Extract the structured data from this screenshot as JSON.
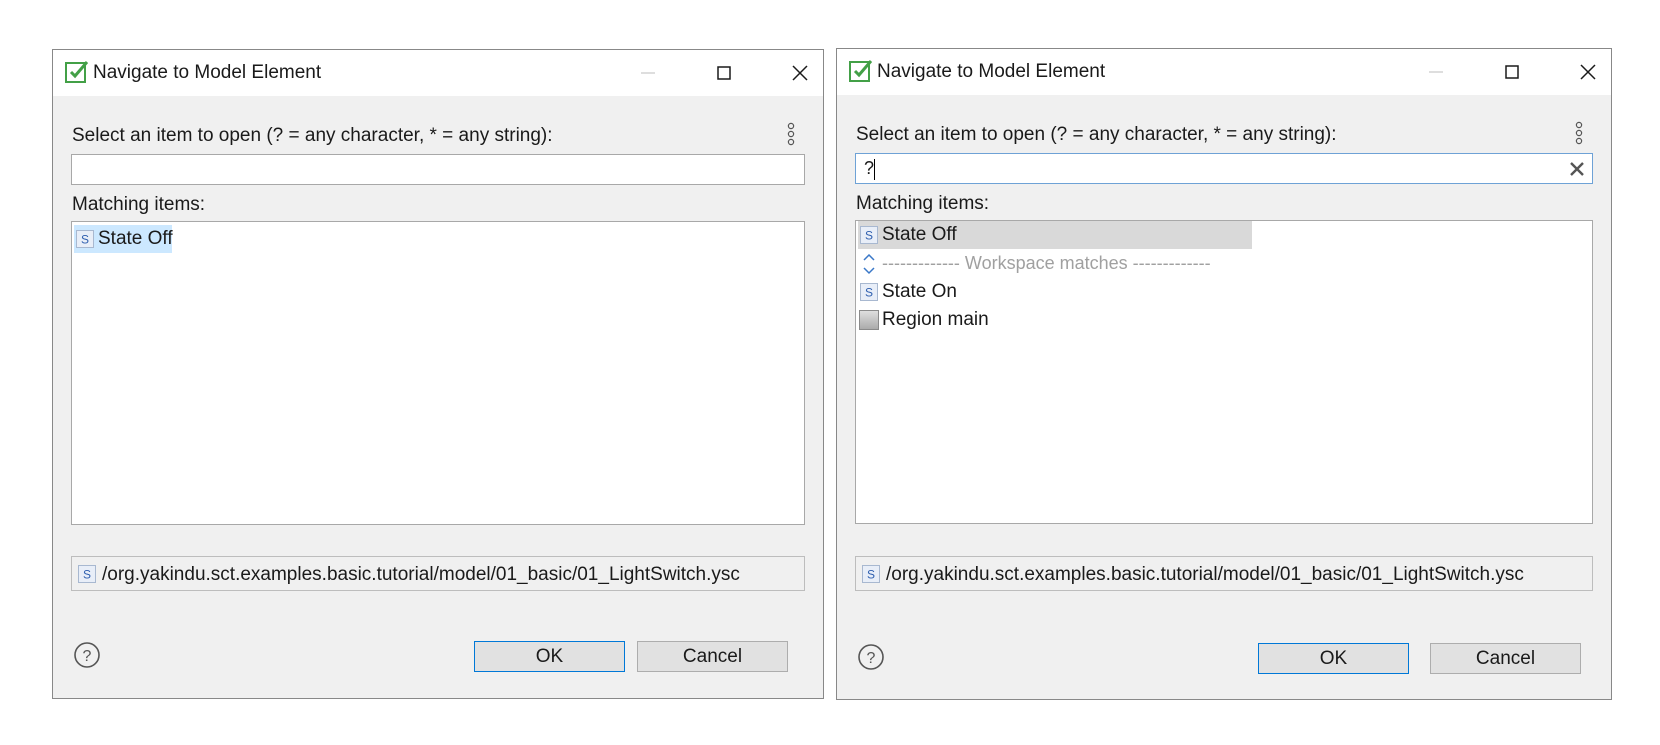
{
  "dialogs": [
    {
      "title": "Navigate to Model Element",
      "prompt": "Select an item to open (? = any character, * = any string):",
      "filter_value": "",
      "matching_label": "Matching items:",
      "items": [
        {
          "label": "State Off",
          "icon": "state-icon",
          "selected": true
        }
      ],
      "path": "/org.yakindu.sct.examples.basic.tutorial/model/01_basic/01_LightSwitch.ysc",
      "ok_label": "OK",
      "cancel_label": "Cancel"
    },
    {
      "title": "Navigate to Model Element",
      "prompt": "Select an item to open (? = any character, * = any string):",
      "filter_value": "?",
      "matching_label": "Matching items:",
      "items": [
        {
          "label": "State Off",
          "icon": "state-icon",
          "selected": true
        },
        {
          "label": "------------- Workspace matches -------------",
          "icon": "expand-collapse-icon",
          "separator": true
        },
        {
          "label": "State On",
          "icon": "state-icon"
        },
        {
          "label": "Region main",
          "icon": "region-icon"
        }
      ],
      "path": "/org.yakindu.sct.examples.basic.tutorial/model/01_basic/01_LightSwitch.ysc",
      "ok_label": "OK",
      "cancel_label": "Cancel"
    }
  ],
  "colors": {
    "dialog_bg": "#f0f0f0",
    "selection_highlight_left": "#cce8ff",
    "selection_highlight_right": "#d9d9d9",
    "default_button_border": "#0078d7",
    "app_icon_green": "#4caf50"
  }
}
